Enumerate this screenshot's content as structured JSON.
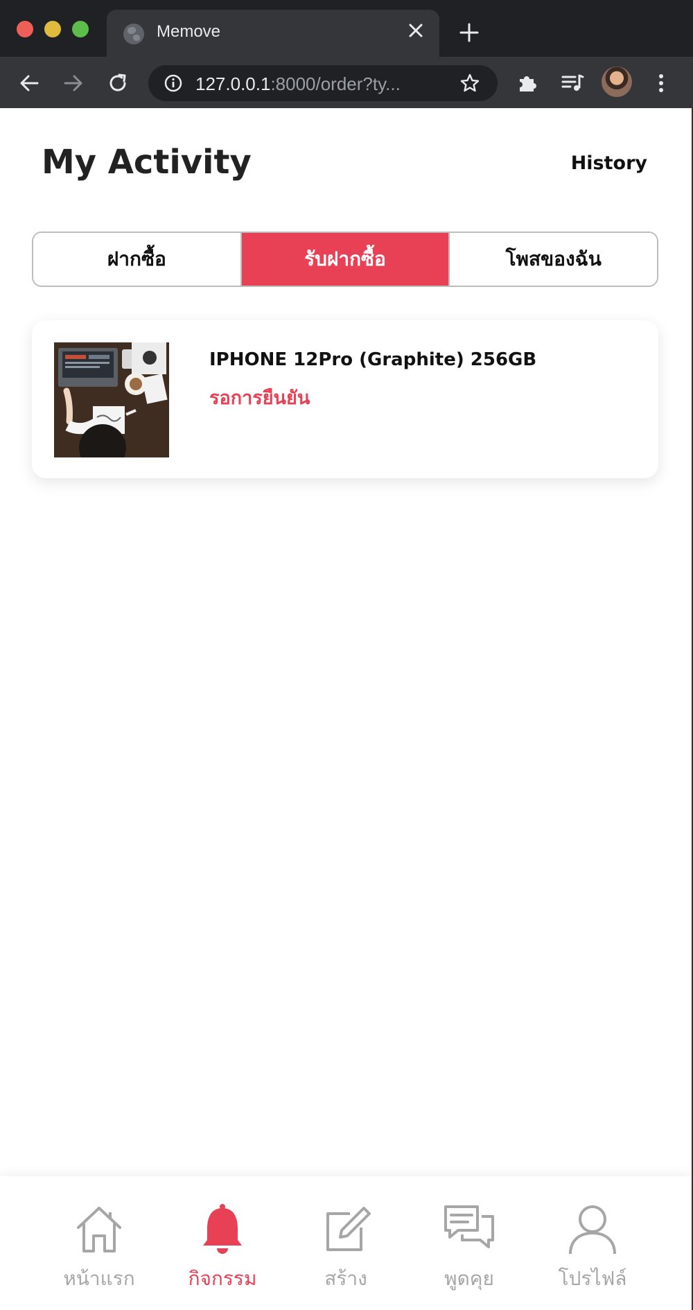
{
  "browser": {
    "tab": {
      "title": "Memove",
      "favicon": "globe-icon"
    },
    "url": {
      "host": "127.0.0.1",
      "rest": ":8000/order?ty..."
    },
    "toolbar_icons": [
      "back-icon",
      "forward-icon",
      "reload-icon",
      "info-icon",
      "star-icon",
      "puzzle-icon",
      "media-queue-icon",
      "avatar",
      "more-icon"
    ]
  },
  "header": {
    "title": "My Activity",
    "history": "History"
  },
  "tabs": [
    {
      "label": "ฝากซื้อ",
      "active": false
    },
    {
      "label": "รับฝากซื้อ",
      "active": true
    },
    {
      "label": "โพสของฉัน",
      "active": false
    }
  ],
  "orders": [
    {
      "title": "IPHONE 12Pro (Graphite) 256GB",
      "status": "รอการยืนยัน"
    }
  ],
  "bottom_nav": [
    {
      "label": "หน้าแรก",
      "icon": "home-icon",
      "active": false
    },
    {
      "label": "กิจกรรม",
      "icon": "bell-icon",
      "active": true
    },
    {
      "label": "สร้าง",
      "icon": "edit-icon",
      "active": false
    },
    {
      "label": "พูดคุย",
      "icon": "chat-icon",
      "active": false
    },
    {
      "label": "โปรไฟล์",
      "icon": "user-icon",
      "active": false
    }
  ],
  "colors": {
    "accent": "#e84054",
    "inactive": "#a6a6a6",
    "chrome_dark": "#202124",
    "chrome_toolbar": "#35363a"
  }
}
